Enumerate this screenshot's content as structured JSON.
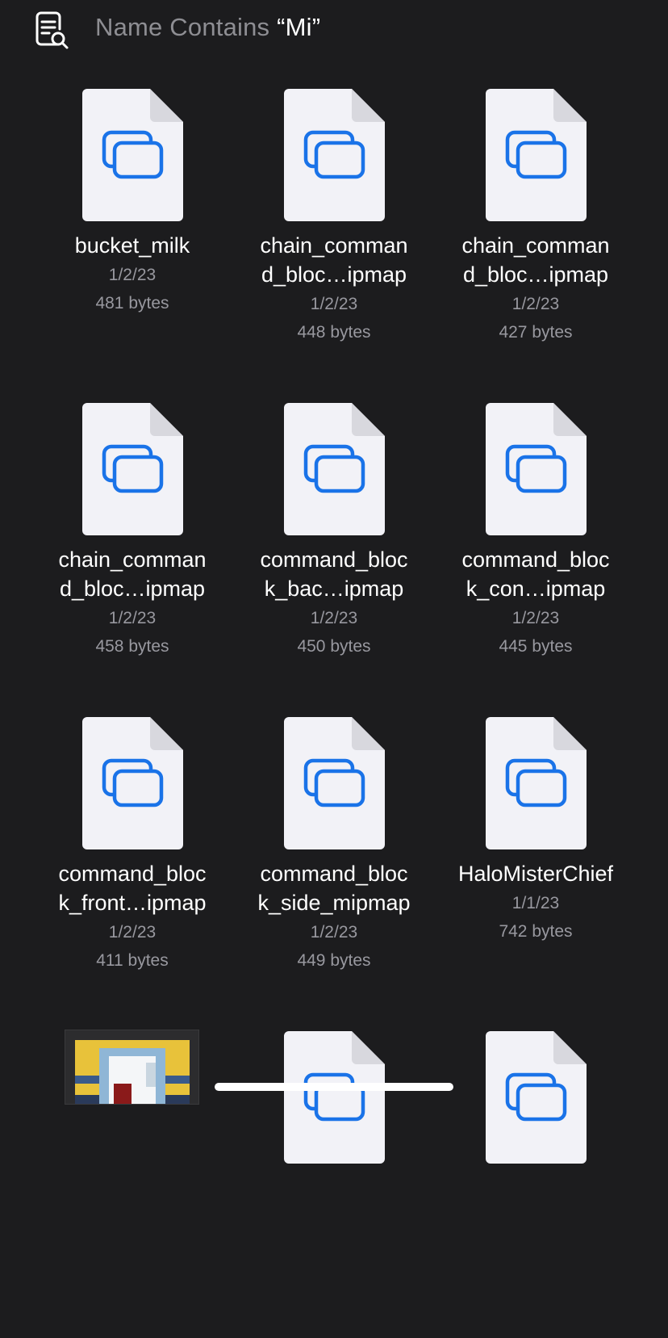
{
  "header": {
    "title_prefix": "Name Contains ",
    "query": "“Mi”"
  },
  "files": [
    {
      "name": "bucket_milk",
      "date": "1/2/23",
      "size": "481 bytes",
      "icon": "stacked-windows-icon"
    },
    {
      "name": "chain_comman\nd_bloc…ipmap",
      "date": "1/2/23",
      "size": "448 bytes",
      "icon": "stacked-windows-icon"
    },
    {
      "name": "chain_comman\nd_bloc…ipmap",
      "date": "1/2/23",
      "size": "427 bytes",
      "icon": "stacked-windows-icon"
    },
    {
      "name": "chain_comman\nd_bloc…ipmap",
      "date": "1/2/23",
      "size": "458 bytes",
      "icon": "stacked-windows-icon"
    },
    {
      "name": "command_bloc\nk_bac…ipmap",
      "date": "1/2/23",
      "size": "450 bytes",
      "icon": "stacked-windows-icon"
    },
    {
      "name": "command_bloc\nk_con…ipmap",
      "date": "1/2/23",
      "size": "445 bytes",
      "icon": "stacked-windows-icon"
    },
    {
      "name": "command_bloc\nk_front…ipmap",
      "date": "1/2/23",
      "size": "411 bytes",
      "icon": "stacked-windows-icon"
    },
    {
      "name": "command_bloc\nk_side_mipmap",
      "date": "1/2/23",
      "size": "449 bytes",
      "icon": "stacked-windows-icon"
    },
    {
      "name": "HaloMisterChief",
      "date": "1/1/23",
      "size": "742 bytes",
      "icon": "stacked-windows-icon"
    }
  ],
  "colors": {
    "background": "#1c1c1e",
    "accent": "#1a73e8",
    "secondary_text": "#98989f"
  }
}
